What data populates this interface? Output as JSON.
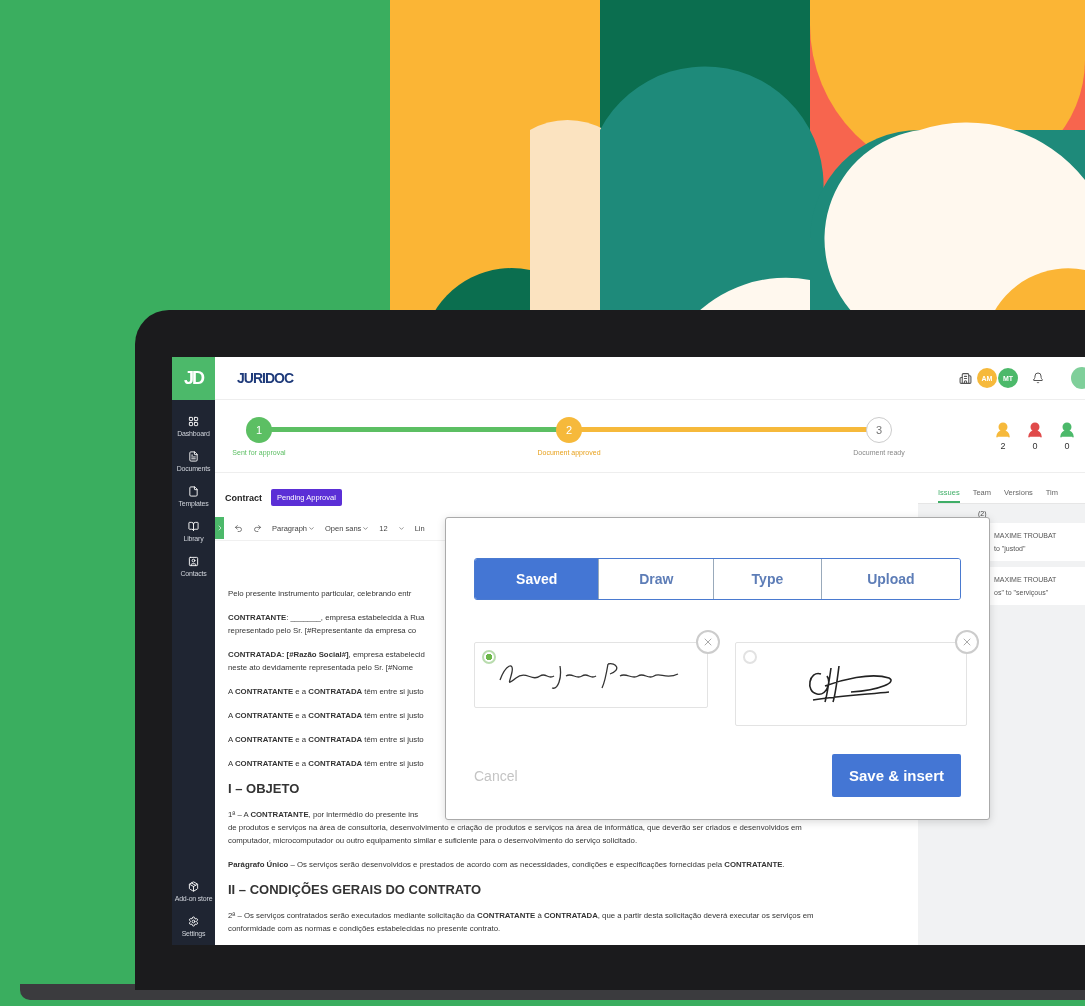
{
  "sidebar": {
    "logo": "JD",
    "items": [
      {
        "label": "Dashboard"
      },
      {
        "label": "Documents"
      },
      {
        "label": "Templates"
      },
      {
        "label": "Library"
      },
      {
        "label": "Contacts"
      }
    ],
    "bottom_items": [
      {
        "label": "Add-on store"
      },
      {
        "label": "Settings"
      }
    ]
  },
  "header": {
    "logo": "JURIDOC",
    "avatars": [
      {
        "initials": "AM",
        "color": "#f6b93b"
      },
      {
        "initials": "MT",
        "color": "#4cb96a"
      }
    ]
  },
  "steps": [
    {
      "number": "1",
      "label": "Sent for approval",
      "completed": true,
      "current": false
    },
    {
      "number": "2",
      "label": "Document approved",
      "completed": false,
      "current": true
    },
    {
      "number": "3",
      "label": "Document ready",
      "completed": false,
      "current": false
    }
  ],
  "counters": [
    {
      "count": "2",
      "color": "#f6b93b"
    },
    {
      "count": "0",
      "color": "#e04b4b"
    },
    {
      "count": "0",
      "color": "#4cb96a"
    }
  ],
  "document": {
    "title": "Contract",
    "status": "Pending Approval",
    "toolbar": {
      "style": "Paragraph",
      "font": "Open sans",
      "size": "12",
      "cut_item": "Lin"
    },
    "blocks": [
      {
        "kind": "para",
        "lines": [
          "Pelo presente instrumento particular, celebrando entr"
        ]
      },
      {
        "kind": "para",
        "lines": [
          "**CONTRATANTE**: _______, empresa estabelecida à Rua",
          "representado pelo Sr. [#Representante da empresa co"
        ]
      },
      {
        "kind": "para",
        "lines": [
          "**CONTRATADA: [#Razão Social#]**, empresa estabelecid",
          "neste ato devidamente representada pelo Sr. [#Nome"
        ]
      },
      {
        "kind": "para",
        "lines": [
          "A **CONTRATANTE** e a **CONTRATADA** têm entre si justo"
        ]
      },
      {
        "kind": "para",
        "lines": [
          "A **CONTRATANTE** e a **CONTRATADA** têm entre si justo"
        ]
      },
      {
        "kind": "para",
        "lines": [
          "A **CONTRATANTE** e a **CONTRATADA** têm entre si justo"
        ]
      },
      {
        "kind": "para",
        "lines": [
          "A **CONTRATANTE** e a **CONTRATADA** têm entre si justo"
        ]
      },
      {
        "kind": "heading",
        "lines": [
          "I – OBJETO"
        ]
      },
      {
        "kind": "para",
        "lines": [
          "1ª – A **CONTRATANTE**, por intermédio do presente ins",
          "de produtos e serviços na área de consultoria, desenvolvimento e criação de produtos e serviços na área de informática, que deverão ser criados e desenvolvidos em",
          "computador, microcomputador ou outro equipamento similar e suficiente para o desenvolvimento do serviço solicitado."
        ]
      },
      {
        "kind": "para",
        "lines": [
          "**Parágrafo Único** – Os serviços serão desenvolvidos e prestados de acordo com as necessidades, condições e especificações fornecidas pela **CONTRATANTE**."
        ]
      },
      {
        "kind": "heading",
        "lines": [
          "II – CONDIÇÕES GERAIS DO CONTRATO"
        ]
      },
      {
        "kind": "para",
        "lines": [
          "2ª – Os serviços contratados serão executados mediante solicitação da **CONTRATANTE** à **CONTRATADA**, que a partir desta solicitação deverá executar os serviços em",
          "conformidade com as normas e condições estabelecidas no presente contrato."
        ]
      }
    ]
  },
  "side_panel": {
    "tabs": [
      {
        "label": "Issues",
        "selected": true
      },
      {
        "label": "Team",
        "selected": false
      },
      {
        "label": "Versions",
        "selected": false
      },
      {
        "label": "Tim",
        "selected": false
      }
    ],
    "count": "(2)",
    "issues": [
      {
        "author": "MAXIME TROUBAT",
        "text": "to \"justod\""
      },
      {
        "author": "MAXIME TROUBAT",
        "text": "os\" to \"serviçous\""
      }
    ]
  },
  "modal": {
    "tabs": [
      {
        "label": "Saved",
        "selected": true
      },
      {
        "label": "Draw",
        "selected": false
      },
      {
        "label": "Type",
        "selected": false
      },
      {
        "label": "Upload",
        "selected": false
      }
    ],
    "signatures": [
      {
        "selected": true
      },
      {
        "selected": false
      }
    ],
    "cancel": "Cancel",
    "submit": "Save & insert"
  }
}
